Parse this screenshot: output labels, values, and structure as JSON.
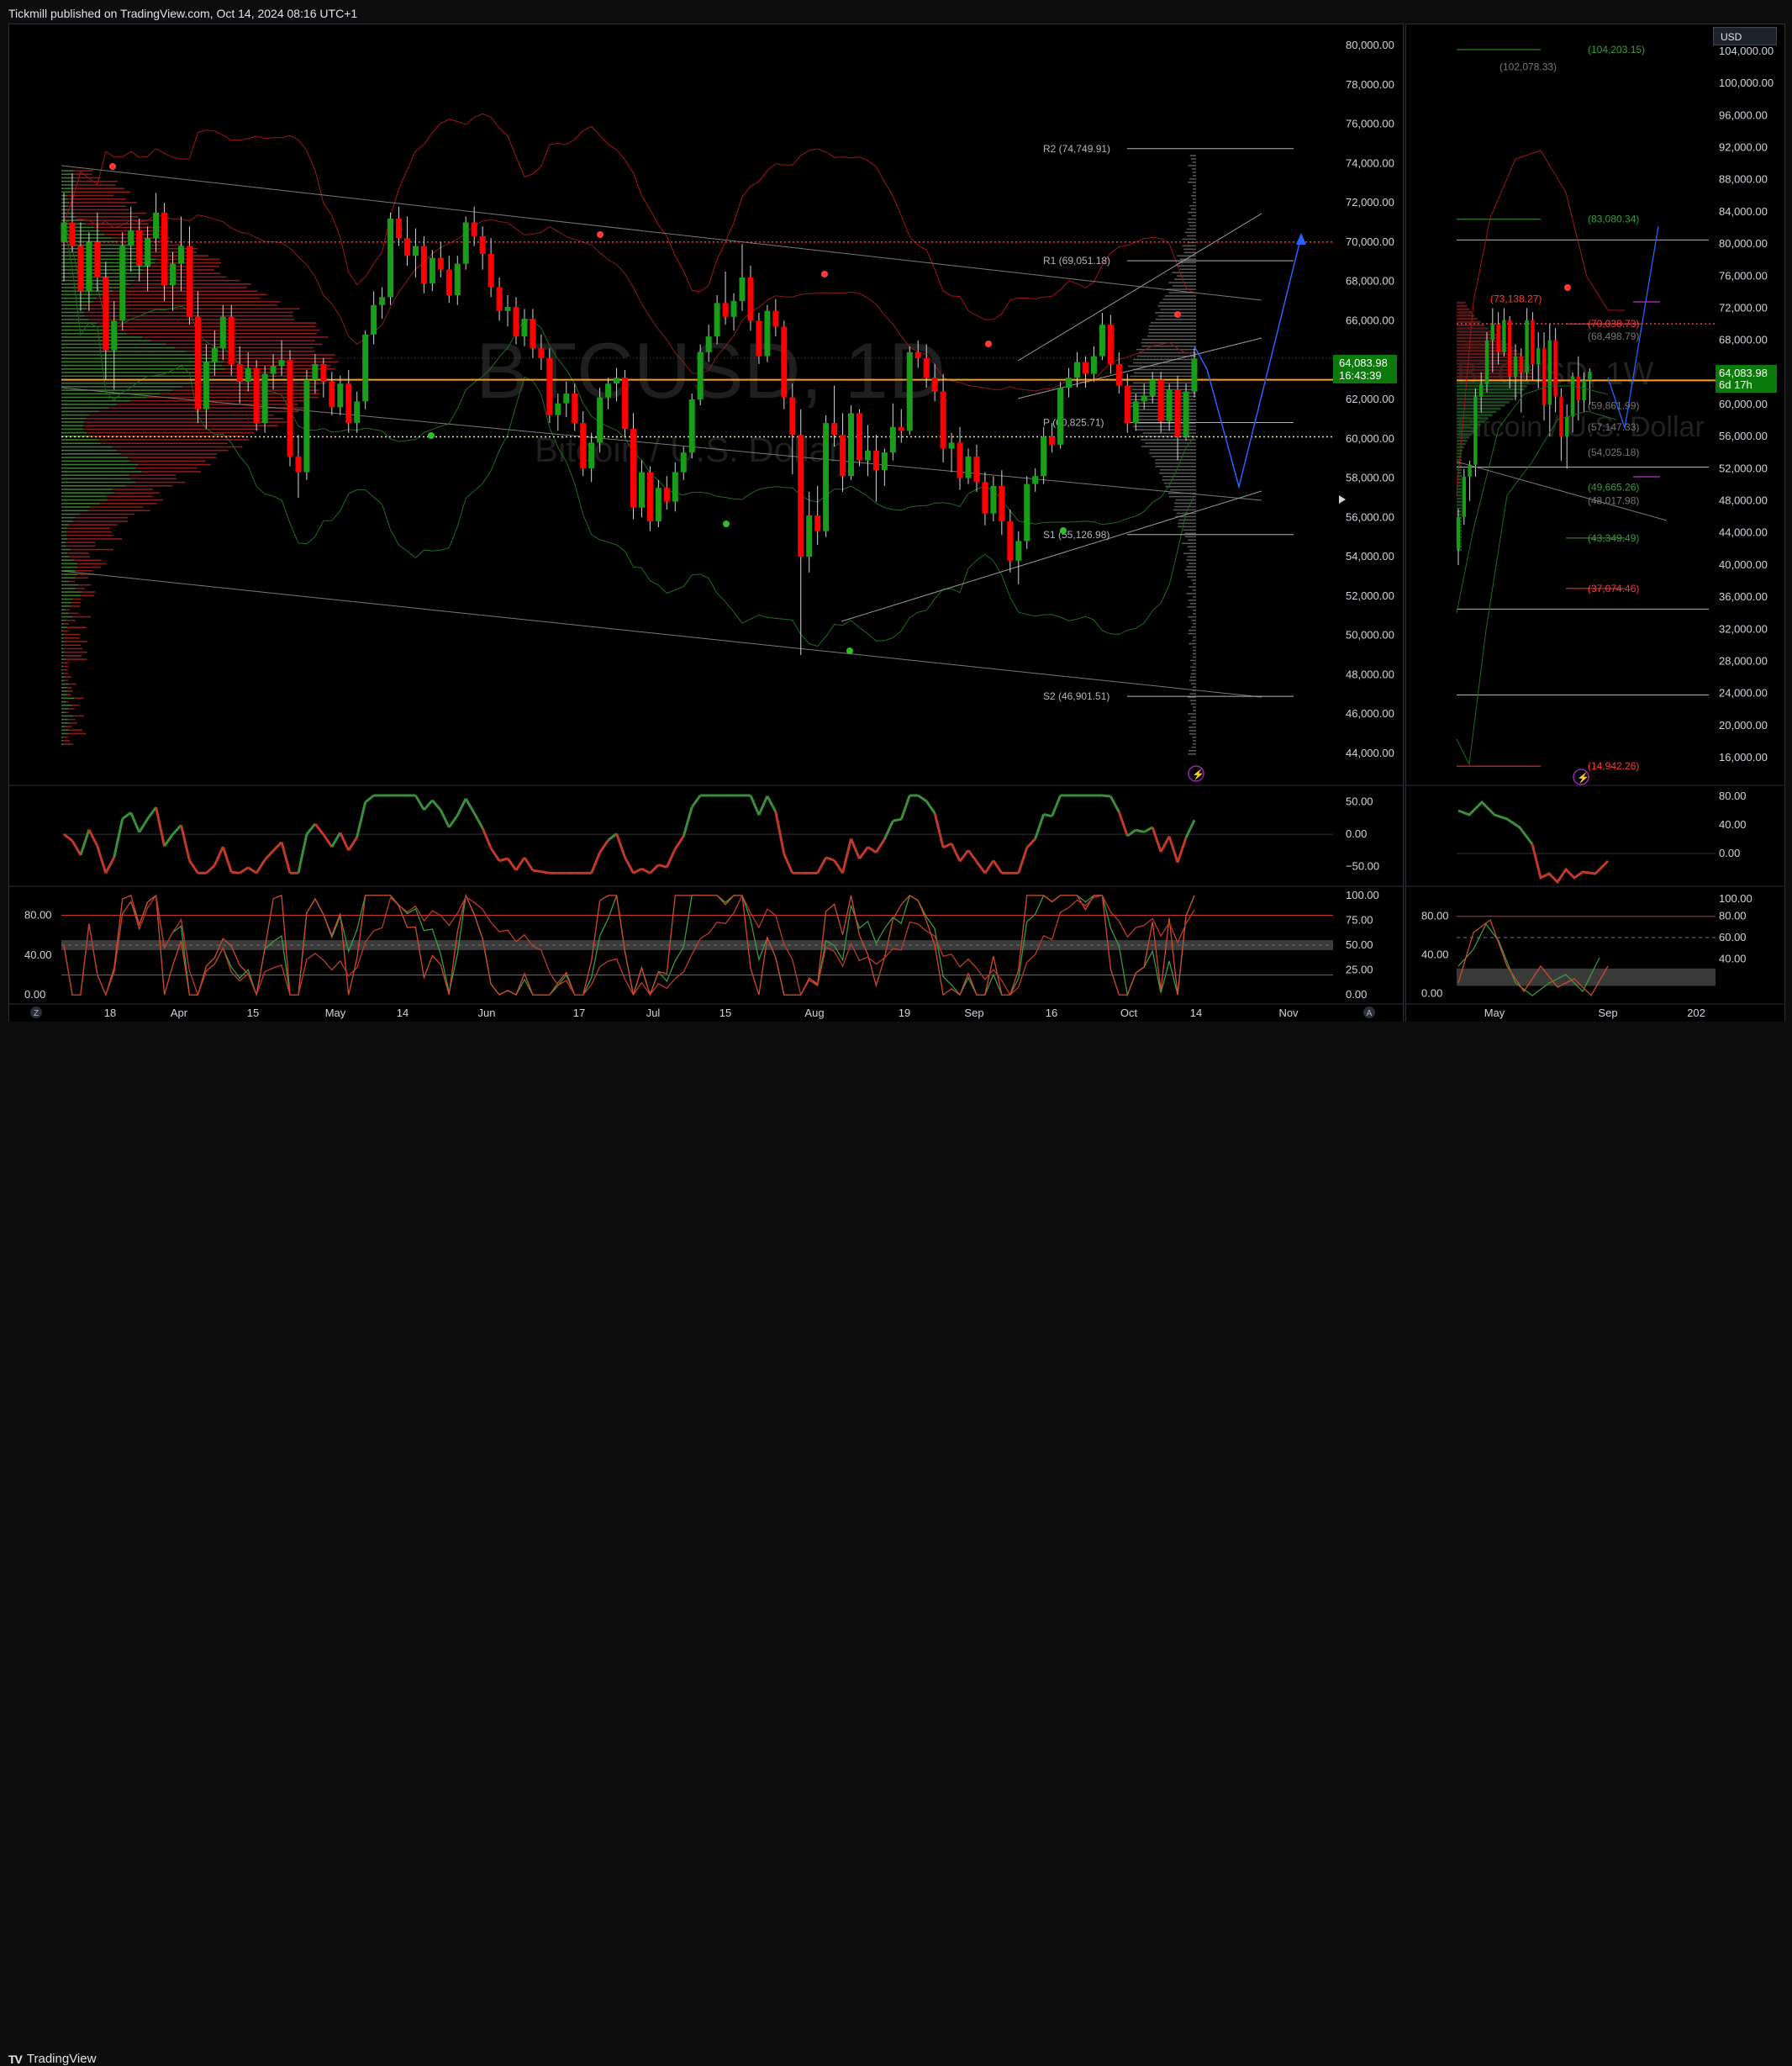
{
  "header": {
    "published": "Tickmill published on TradingView.com, Oct 14, 2024 08:16 UTC+1"
  },
  "footer": {
    "brand": "TradingView"
  },
  "currency_button": "USD",
  "colors": {
    "up": "#089981",
    "up_candle": "#1f8f1f",
    "down": "#ff0000",
    "accent_orange": "#f7a21b",
    "price_label": "#0b7a0b",
    "projection": "#2962ff"
  },
  "main": {
    "watermark_symbol": "BTCUSD, 1D",
    "watermark_name": "Bitcoin / U.S. Dollar",
    "price_axis_labels": [
      "80,000.00",
      "78,000.00",
      "76,000.00",
      "74,000.00",
      "72,000.00",
      "70,000.00",
      "68,000.00",
      "66,000.00",
      "64,000.00",
      "62,000.00",
      "60,000.00",
      "58,000.00",
      "56,000.00",
      "54,000.00",
      "52,000.00",
      "50,000.00",
      "48,000.00",
      "46,000.00",
      "44,000.00"
    ],
    "current_price": "64,083.98",
    "countdown": "16:43:39",
    "pivot_labels": [
      "R2 (74,749.91)",
      "R1 (69,051.18)",
      "P (60,825.71)",
      "S1 (55,126.98)",
      "S2 (46,901.51)"
    ],
    "time_axis": [
      "18",
      "Apr",
      "15",
      "May",
      "14",
      "Jun",
      "17",
      "Jul",
      "15",
      "Aug",
      "19",
      "Sep",
      "16",
      "Oct",
      "14",
      "Nov"
    ],
    "osc1_axis": [
      "50.00",
      "0.00",
      "−50.00"
    ],
    "osc2_axis_left": [
      "80.00",
      "40.00",
      "0.00"
    ],
    "osc2_axis_right": [
      "100.00",
      "75.00",
      "50.00",
      "25.00",
      "0.00"
    ],
    "z_label": "Z",
    "a_label": "A"
  },
  "side": {
    "watermark_symbol": "BTCUSD, 1W",
    "watermark_name": "Bitcoin / U.S. Dollar",
    "price_axis_labels": [
      "104,000.00",
      "100,000.00",
      "96,000.00",
      "92,000.00",
      "88,000.00",
      "84,000.00",
      "80,000.00",
      "76,000.00",
      "72,000.00",
      "68,000.00",
      "64,000.00",
      "60,000.00",
      "56,000.00",
      "52,000.00",
      "48,000.00",
      "44,000.00",
      "40,000.00",
      "36,000.00",
      "32,000.00",
      "28,000.00",
      "24,000.00",
      "20,000.00",
      "16,000.00"
    ],
    "current_price": "64,083.98",
    "countdown": "6d 17h",
    "level_labels": [
      "(104,203.15)",
      "(102,078.33)",
      "(83,080.34)",
      "(73,138.27)",
      "(70,038.73)",
      "(68,498.79)",
      "(59,861.99)",
      "(57,147.33)",
      "(54,025.18)",
      "(49,665.26)",
      "(48,017.98)",
      "(43,349.49)",
      "(37,074.46)",
      "(14,942.26)"
    ],
    "time_axis": [
      "May",
      "Sep",
      "202"
    ],
    "osc1_axis": [
      "80.00",
      "40.00",
      "0.00"
    ],
    "osc2_axis_left": [
      "80.00",
      "40.00",
      "0.00"
    ],
    "osc2_axis_right": [
      "100.00",
      "80.00",
      "60.00",
      "40.00"
    ]
  },
  "chart_data": {
    "type": "candlestick",
    "title": "BTCUSD, 1D",
    "ylabel": "",
    "ylim": [
      43000,
      81000
    ],
    "pivots": {
      "R2": 74749.91,
      "R1": 69051.18,
      "P": 60825.71,
      "S1": 55126.98,
      "S2": 46901.51
    },
    "last_price": 64083.98,
    "ohlc": [
      [
        70000,
        72500,
        68000,
        71000
      ],
      [
        71000,
        73500,
        69500,
        69800
      ],
      [
        69800,
        71000,
        66500,
        67500
      ],
      [
        67500,
        70500,
        66500,
        70000
      ],
      [
        70000,
        71500,
        67500,
        68200
      ],
      [
        68200,
        69000,
        63000,
        64500
      ],
      [
        64500,
        67000,
        62500,
        66000
      ],
      [
        66000,
        70500,
        65500,
        69800
      ],
      [
        69800,
        71800,
        68500,
        70600
      ],
      [
        70600,
        71200,
        68000,
        68800
      ],
      [
        68800,
        70800,
        67500,
        70200
      ],
      [
        70200,
        72500,
        69500,
        71500
      ],
      [
        71500,
        72000,
        67000,
        67800
      ],
      [
        67800,
        69500,
        66500,
        68900
      ],
      [
        68900,
        71300,
        67500,
        69800
      ],
      [
        69800,
        70800,
        65800,
        66200
      ],
      [
        66200,
        67500,
        60800,
        61500
      ],
      [
        61500,
        64800,
        60500,
        63900
      ],
      [
        63900,
        65500,
        63200,
        64600
      ],
      [
        64600,
        66800,
        64000,
        66200
      ],
      [
        66200,
        66800,
        63200,
        63800
      ],
      [
        63800,
        64700,
        61800,
        62900
      ],
      [
        62900,
        64400,
        62400,
        63600
      ],
      [
        63600,
        64000,
        60400,
        60800
      ],
      [
        60800,
        63700,
        60300,
        63300
      ],
      [
        63300,
        64300,
        62500,
        63700
      ],
      [
        63700,
        65000,
        63200,
        64000
      ],
      [
        64000,
        64500,
        58600,
        59100
      ],
      [
        59100,
        60200,
        57000,
        58300
      ],
      [
        58300,
        63500,
        57900,
        63000
      ],
      [
        63000,
        64300,
        62300,
        63800
      ],
      [
        63800,
        64100,
        62100,
        62900
      ],
      [
        62900,
        63400,
        61200,
        61600
      ],
      [
        61600,
        63200,
        61200,
        62800
      ],
      [
        62800,
        63500,
        60300,
        60800
      ],
      [
        60800,
        62400,
        60300,
        61900
      ],
      [
        61900,
        65500,
        61500,
        65300
      ],
      [
        65300,
        67500,
        64800,
        66800
      ],
      [
        66800,
        67700,
        66100,
        67200
      ],
      [
        67200,
        71500,
        66800,
        71200
      ],
      [
        71200,
        71800,
        69800,
        70200
      ],
      [
        70200,
        71300,
        68800,
        69300
      ],
      [
        69300,
        70700,
        68200,
        69800
      ],
      [
        69800,
        70300,
        67400,
        67900
      ],
      [
        67900,
        69600,
        67500,
        69200
      ],
      [
        69200,
        70000,
        68200,
        68600
      ],
      [
        68600,
        69300,
        66900,
        67300
      ],
      [
        67300,
        69300,
        66800,
        68900
      ],
      [
        68900,
        71300,
        68600,
        71000
      ],
      [
        71000,
        71800,
        69800,
        70300
      ],
      [
        70300,
        70800,
        68600,
        69400
      ],
      [
        69400,
        70200,
        67200,
        67700
      ],
      [
        67700,
        68200,
        66000,
        66500
      ],
      [
        66500,
        67300,
        65700,
        66700
      ],
      [
        66700,
        67200,
        64800,
        65200
      ],
      [
        65200,
        66600,
        64700,
        66100
      ],
      [
        66100,
        66600,
        64100,
        64600
      ],
      [
        64600,
        65300,
        63500,
        64100
      ],
      [
        64100,
        64600,
        60800,
        61200
      ],
      [
        61200,
        62300,
        60400,
        61800
      ],
      [
        61800,
        62900,
        61100,
        62300
      ],
      [
        62300,
        62800,
        60400,
        60800
      ],
      [
        60800,
        61400,
        58100,
        58500
      ],
      [
        58500,
        60300,
        57800,
        59800
      ],
      [
        59800,
        62600,
        59300,
        62100
      ],
      [
        62100,
        63100,
        61500,
        62800
      ],
      [
        62800,
        63600,
        61900,
        63100
      ],
      [
        63100,
        63500,
        60100,
        60500
      ],
      [
        60500,
        61300,
        55900,
        56500
      ],
      [
        56500,
        58900,
        56000,
        58300
      ],
      [
        58300,
        58600,
        55300,
        55800
      ],
      [
        55800,
        57900,
        55500,
        57500
      ],
      [
        57500,
        58100,
        56400,
        56800
      ],
      [
        56800,
        58800,
        56300,
        58300
      ],
      [
        58300,
        59600,
        57900,
        59300
      ],
      [
        59300,
        62300,
        59000,
        62000
      ],
      [
        62000,
        64800,
        61700,
        64400
      ],
      [
        64400,
        65800,
        63900,
        65200
      ],
      [
        65200,
        67300,
        64800,
        66900
      ],
      [
        66900,
        68500,
        65800,
        66200
      ],
      [
        66200,
        67400,
        65500,
        67000
      ],
      [
        67000,
        69900,
        66500,
        68200
      ],
      [
        68200,
        68800,
        65500,
        66000
      ],
      [
        66000,
        66400,
        63800,
        64200
      ],
      [
        64200,
        66800,
        63900,
        66500
      ],
      [
        66500,
        67100,
        65200,
        65700
      ],
      [
        65700,
        66000,
        61500,
        62100
      ],
      [
        62100,
        62800,
        58200,
        60200
      ],
      [
        60200,
        61500,
        49000,
        54000
      ],
      [
        54000,
        57300,
        53200,
        56100
      ],
      [
        56100,
        57600,
        54600,
        55300
      ],
      [
        55300,
        61200,
        55000,
        60800
      ],
      [
        60800,
        62700,
        59600,
        60200
      ],
      [
        60200,
        61300,
        57300,
        58100
      ],
      [
        58100,
        61700,
        57900,
        61300
      ],
      [
        61300,
        61500,
        58600,
        58900
      ],
      [
        58900,
        60700,
        58100,
        59400
      ],
      [
        59400,
        60200,
        56800,
        58400
      ],
      [
        58400,
        59500,
        57600,
        59300
      ],
      [
        59300,
        61800,
        58900,
        60600
      ],
      [
        60600,
        61500,
        59800,
        60400
      ],
      [
        60400,
        64700,
        60200,
        64400
      ],
      [
        64400,
        65000,
        63600,
        64100
      ],
      [
        64100,
        64800,
        62600,
        63100
      ],
      [
        63100,
        63800,
        61900,
        62400
      ],
      [
        62400,
        63300,
        58800,
        59500
      ],
      [
        59500,
        60300,
        58300,
        59800
      ],
      [
        59800,
        60600,
        57400,
        58000
      ],
      [
        58000,
        59500,
        57700,
        59100
      ],
      [
        59100,
        59700,
        57300,
        57800
      ],
      [
        57800,
        58300,
        55600,
        56200
      ],
      [
        56200,
        58100,
        55800,
        57600
      ],
      [
        57600,
        58400,
        55100,
        55800
      ],
      [
        55800,
        56400,
        53200,
        53800
      ],
      [
        53800,
        55300,
        52600,
        54800
      ],
      [
        54800,
        58100,
        54400,
        57700
      ],
      [
        57700,
        58500,
        57300,
        58100
      ],
      [
        58100,
        60600,
        57700,
        60100
      ],
      [
        60100,
        60800,
        59300,
        59700
      ],
      [
        59700,
        62900,
        59500,
        62600
      ],
      [
        62600,
        63600,
        62100,
        63100
      ],
      [
        63100,
        64400,
        62600,
        63900
      ],
      [
        63900,
        64200,
        62600,
        63300
      ],
      [
        63300,
        64700,
        62900,
        64200
      ],
      [
        64200,
        66400,
        64000,
        65800
      ],
      [
        65800,
        66300,
        63300,
        63800
      ],
      [
        63800,
        64400,
        62300,
        62700
      ],
      [
        62700,
        63300,
        60300,
        60800
      ],
      [
        60800,
        62300,
        60400,
        61900
      ],
      [
        61900,
        62800,
        61500,
        62200
      ],
      [
        62200,
        63400,
        61800,
        63000
      ],
      [
        63000,
        63400,
        60300,
        60900
      ],
      [
        60900,
        62800,
        60400,
        62500
      ],
      [
        62500,
        63200,
        58900,
        60100
      ],
      [
        60100,
        62800,
        59900,
        62400
      ],
      [
        62400,
        64600,
        62100,
        64083.98
      ]
    ]
  }
}
